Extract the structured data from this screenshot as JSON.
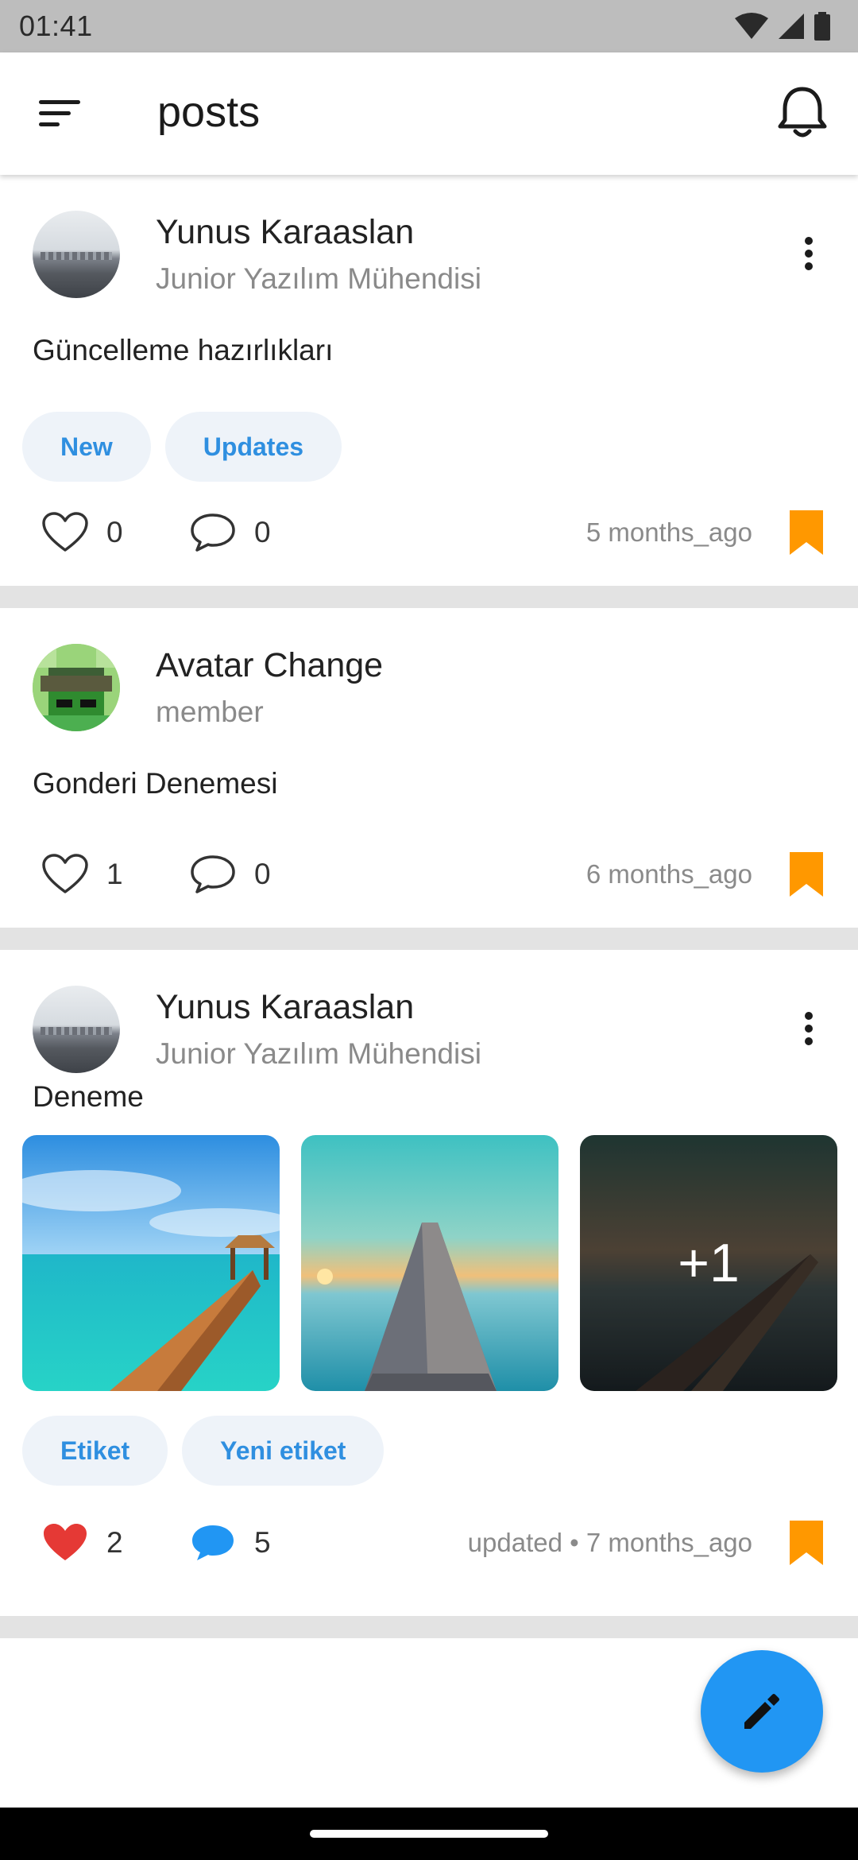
{
  "status_bar": {
    "time": "01:41",
    "icons": [
      "wifi-icon",
      "signal-icon",
      "battery-icon"
    ]
  },
  "app_bar": {
    "title": "posts",
    "left_icon": "menu-icon",
    "right_icon": "bell-icon"
  },
  "colors": {
    "accent": "#2196f3",
    "tag_text": "#2f8fe0",
    "tag_bg": "#eef3f9",
    "bookmark": "#ff9800",
    "like_active": "#e53935",
    "comment_active": "#2196f3"
  },
  "posts": [
    {
      "author": "Yunus Karaaslan",
      "role": "Junior Yazılım Mühendisi",
      "text": "Güncelleme hazırlıkları",
      "tags": [
        "New",
        "Updates"
      ],
      "likes": "0",
      "comments": "0",
      "time": "5 months_ago",
      "liked": false,
      "commented": false
    },
    {
      "author": "Avatar Change",
      "role": "member",
      "text": "Gonderi Denemesi",
      "tags": [],
      "likes": "1",
      "comments": "0",
      "time": "6 months_ago",
      "liked": false,
      "commented": false
    },
    {
      "author": "Yunus Karaaslan",
      "role": "Junior Yazılım Mühendisi",
      "text": "Deneme",
      "images": [
        "tropical-pier-photo",
        "sunset-pier-photo",
        "dusk-pier-photo"
      ],
      "more_images": "+1",
      "tags": [
        "Etiket",
        "Yeni etiket"
      ],
      "likes": "2",
      "comments": "5",
      "time": "updated • 7 months_ago",
      "liked": true,
      "commented": true
    }
  ],
  "fab": {
    "icon": "pencil-icon"
  }
}
